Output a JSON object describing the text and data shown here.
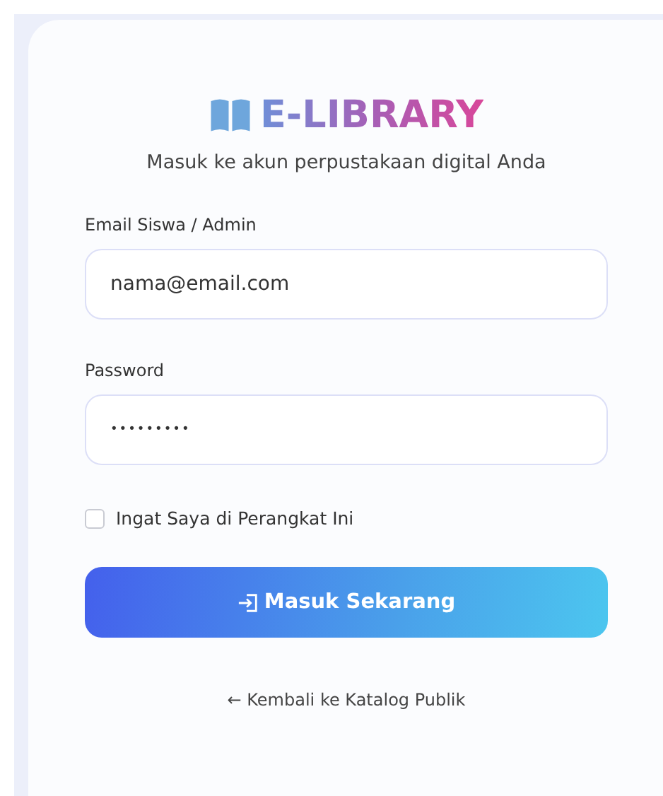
{
  "brand": {
    "title": "E-LIBRARY",
    "subtitle": "Masuk ke akun perpustakaan digital Anda"
  },
  "fields": [
    {
      "label": "Email Siswa / Admin",
      "placeholder": "nama@email.com"
    },
    {
      "label": "Password",
      "value": "•••••••••"
    }
  ],
  "remember": {
    "label": "Ingat Saya di Perangkat Ini",
    "checked": false
  },
  "submit": {
    "label": "Masuk Sekarang"
  },
  "back_link": {
    "label": "← Kembali ke Katalog Publik"
  }
}
